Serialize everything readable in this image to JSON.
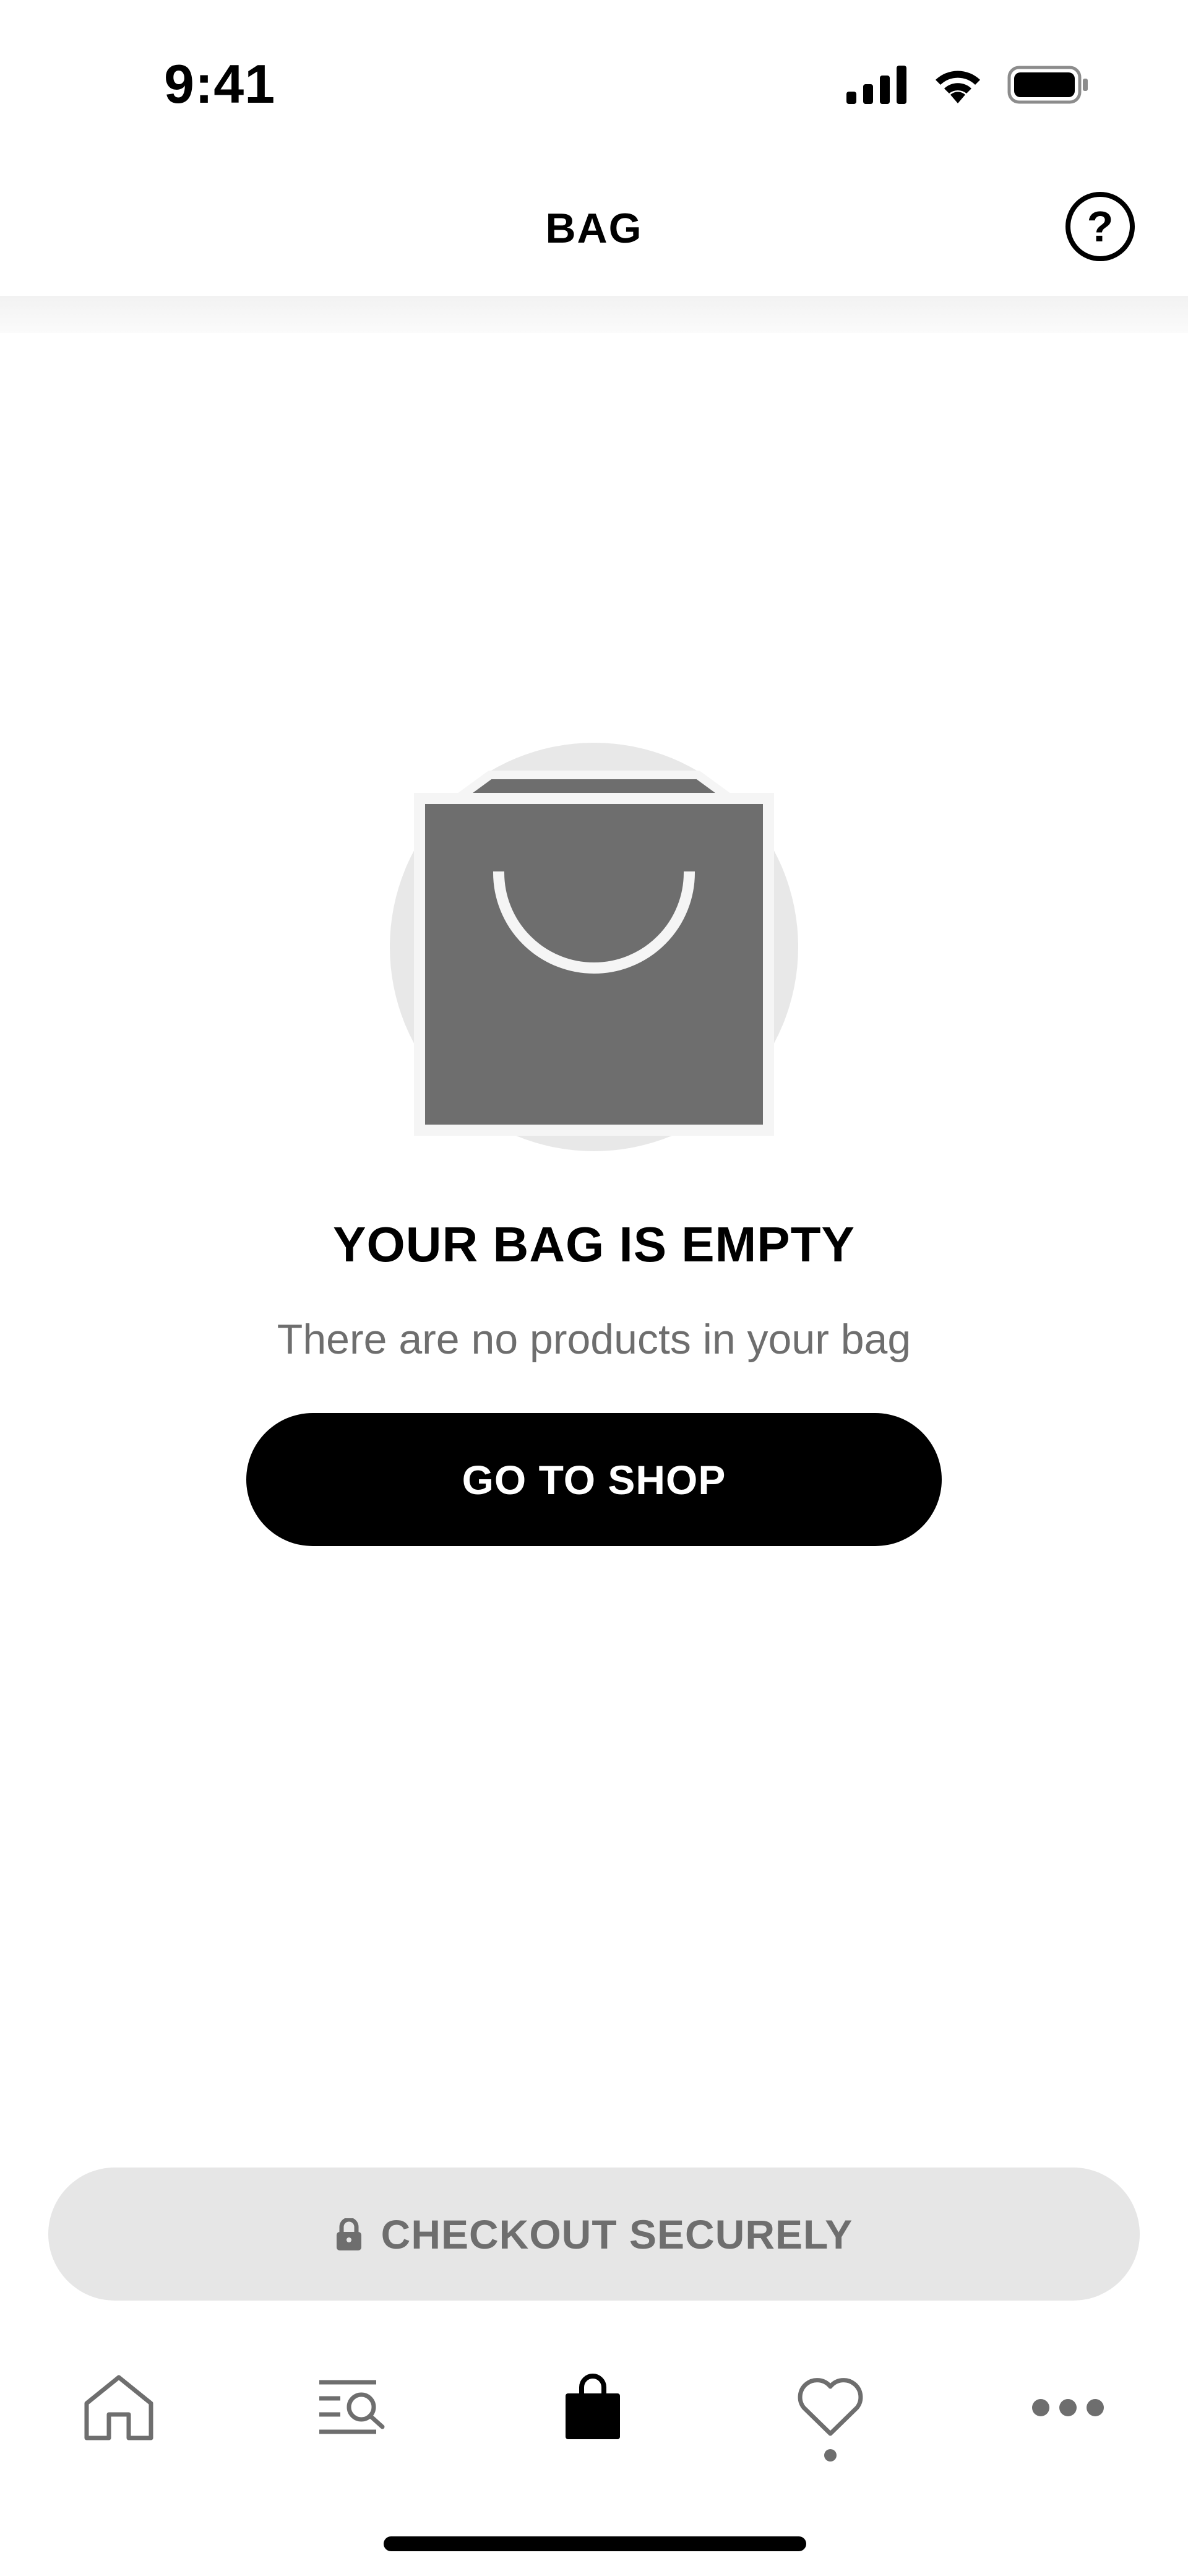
{
  "status_bar": {
    "time": "9:41",
    "icons": [
      "cellular-signal-icon",
      "wifi-icon",
      "battery-icon"
    ]
  },
  "header": {
    "title": "BAG",
    "help_label": "?",
    "help_icon": "question-circle-icon"
  },
  "empty_state": {
    "illustration": "shopping-bag-icon",
    "title": "YOUR BAG IS EMPTY",
    "subtitle": "There are no products in your bag",
    "cta_label": "GO TO SHOP"
  },
  "checkout": {
    "label": "CHECKOUT SECURELY",
    "icon": "lock-icon",
    "enabled": false
  },
  "tab_bar": {
    "tabs": [
      {
        "name": "home",
        "icon": "home-icon",
        "active": false
      },
      {
        "name": "search",
        "icon": "search-menu-icon",
        "active": false
      },
      {
        "name": "bag",
        "icon": "bag-icon",
        "active": true
      },
      {
        "name": "wishlist",
        "icon": "heart-icon",
        "active": false,
        "indicator_dot": true
      },
      {
        "name": "more",
        "icon": "more-icon",
        "active": false
      }
    ]
  },
  "colors": {
    "primary": "#000000",
    "muted": "#6e6e6e",
    "disabled_bg": "#e6e6e6",
    "illustration_bg": "#e8e8e8"
  }
}
